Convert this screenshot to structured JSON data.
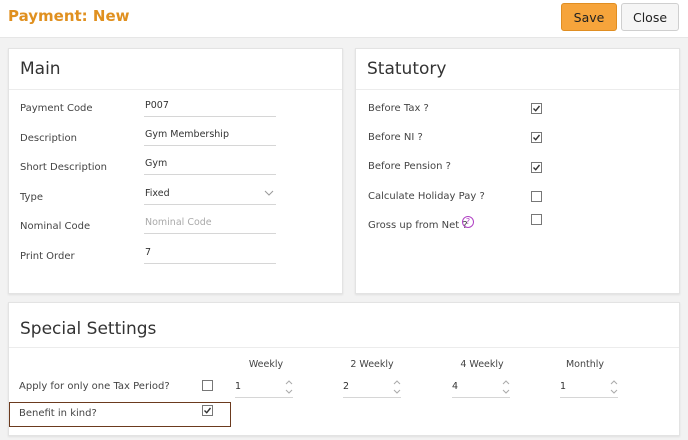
{
  "header": {
    "title": "Payment: New",
    "save_label": "Save",
    "close_label": "Close"
  },
  "main": {
    "title": "Main",
    "fields": [
      {
        "label": "Payment Code",
        "value": "P007"
      },
      {
        "label": "Description",
        "value": "Gym Membership"
      },
      {
        "label": "Short Description",
        "value": "Gym"
      },
      {
        "label": "Type",
        "value": "Fixed"
      },
      {
        "label": "Nominal Code",
        "placeholder": "Nominal Code"
      },
      {
        "label": "Print Order",
        "value": "7"
      }
    ]
  },
  "statutory": {
    "title": "Statutory",
    "items": [
      {
        "label": "Before Tax ?",
        "checked": true
      },
      {
        "label": "Before NI ?",
        "checked": true
      },
      {
        "label": "Before Pension ?",
        "checked": true
      },
      {
        "label": "Calculate Holiday Pay ?",
        "checked": false
      },
      {
        "label": "Gross up from Net ?",
        "checked": false,
        "help": "?"
      }
    ]
  },
  "special": {
    "title": "Special Settings",
    "columns": [
      "Weekly",
      "2 Weekly",
      "4 Weekly",
      "Monthly"
    ],
    "values": [
      "1",
      "2",
      "4",
      "1"
    ],
    "tax_period_label": "Apply for only one Tax Period?",
    "tax_period_checked": false,
    "benefit_label": "Benefit in kind?",
    "benefit_checked": true
  },
  "colors": {
    "accent": "#e0901f",
    "save_bg": "#f6a43b",
    "help": "#b042c4",
    "highlight": "#6b3a1e"
  }
}
